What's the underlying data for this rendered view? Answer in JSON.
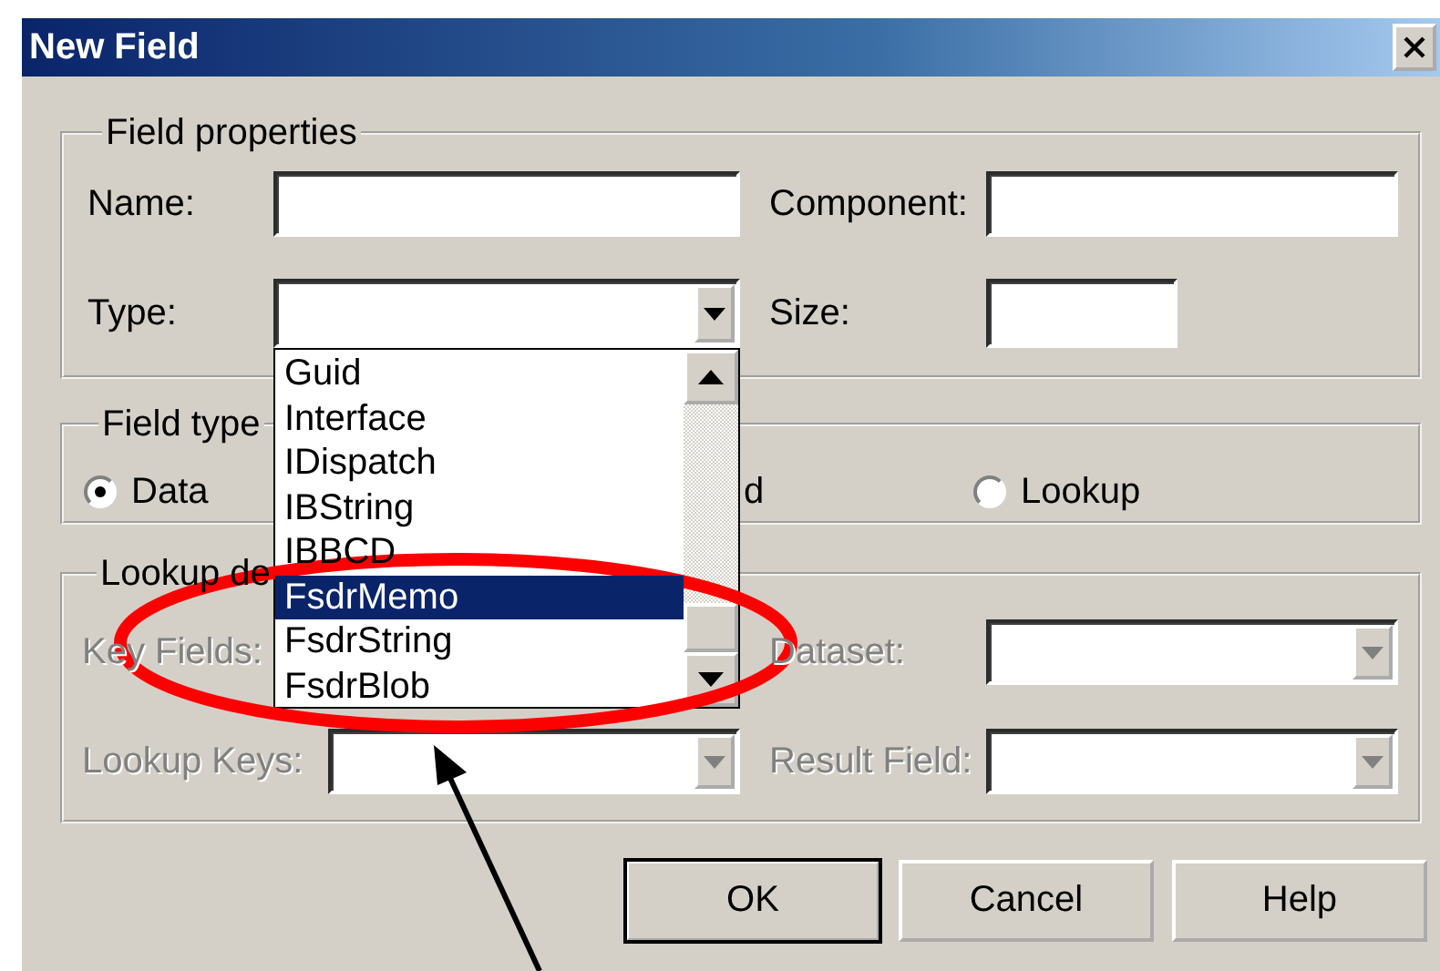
{
  "window": {
    "title": "New Field"
  },
  "field_properties": {
    "title": "Field properties",
    "fields": [
      {
        "label": "Name:",
        "kind": "text",
        "disabled": false
      },
      {
        "label": "Component:",
        "kind": "text",
        "disabled": false
      },
      {
        "label": "Type:",
        "kind": "combo",
        "disabled": false
      },
      {
        "label": "Size:",
        "kind": "short",
        "disabled": false
      }
    ]
  },
  "type_dropdown": {
    "items": [
      {
        "label": "Guid",
        "selected": false
      },
      {
        "label": "Interface",
        "selected": false
      },
      {
        "label": "IDispatch",
        "selected": false
      },
      {
        "label": "IBString",
        "selected": false
      },
      {
        "label": "IBBCD",
        "selected": false
      },
      {
        "label": "FsdrMemo",
        "selected": true
      },
      {
        "label": "FsdrString",
        "selected": false
      },
      {
        "label": "FsdrBlob",
        "selected": false
      }
    ]
  },
  "field_type": {
    "title": "Field type",
    "options": [
      {
        "label": "Data",
        "selected": true
      },
      {
        "label": "Lookup",
        "selected": false
      }
    ],
    "covered_option_text": "d"
  },
  "lookup_definition": {
    "title": "Lookup de",
    "fields": [
      {
        "label": "Key Fields:",
        "kind": "label",
        "disabled": true
      },
      {
        "label": "Dataset:",
        "kind": "combo",
        "disabled": true
      },
      {
        "label": "Lookup Keys:",
        "kind": "combo",
        "disabled": true
      },
      {
        "label": "Result Field:",
        "kind": "combo",
        "disabled": true
      }
    ]
  },
  "buttons": [
    {
      "label": "OK",
      "default": true
    },
    {
      "label": "Cancel",
      "default": false
    },
    {
      "label": "Help",
      "default": false
    }
  ]
}
